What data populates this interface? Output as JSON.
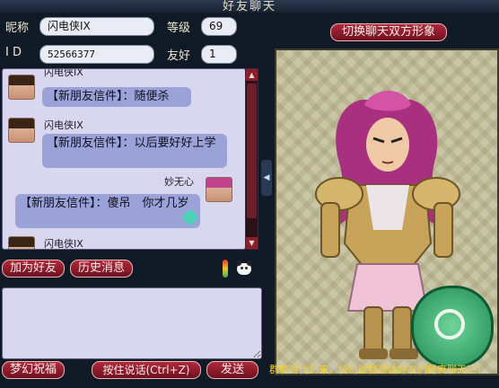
{
  "window": {
    "title": "好友聊天"
  },
  "profile": {
    "nickname_label": "昵称",
    "nickname": "闪电侠IX",
    "level_label": "等级",
    "level": "69",
    "id_label": "I D",
    "id": "52566377",
    "friendship_label": "友好",
    "friendship": "1"
  },
  "messages": [
    {
      "sender": "闪电侠IX",
      "text": "【新朋友信件】：随便杀",
      "side": "left"
    },
    {
      "sender": "闪电侠IX",
      "text": "【新朋友信件】：以后要好好上学",
      "side": "left"
    },
    {
      "sender": "妙无心",
      "text": "【新朋友信件】：傻吊　你才几岁",
      "side": "right"
    },
    {
      "sender": "闪电侠IX",
      "text": "",
      "side": "left"
    }
  ],
  "buttons": {
    "add_friend": "加为好友",
    "history": "历史消息",
    "switch_view": "切换聊天双方形象",
    "blessing": "梦幻祝福",
    "voice": "按住说话(Ctrl+Z)",
    "send": "发送"
  },
  "ticker": {
    "text": "群聊时代到来，快创建群邀请好友们畅爽聊天吧！"
  },
  "colors": {
    "accent": "#8a1f2e",
    "ticker": "#f2cf3a",
    "chat_bg": "#d9d6ef",
    "bubble": "#9aa2d8"
  },
  "icons": [
    "scroll-up-icon",
    "scroll-down-icon",
    "signal-meter-icon",
    "panda-icon",
    "feather-icon",
    "jade-medallion-icon",
    "chevron-left-icon"
  ]
}
